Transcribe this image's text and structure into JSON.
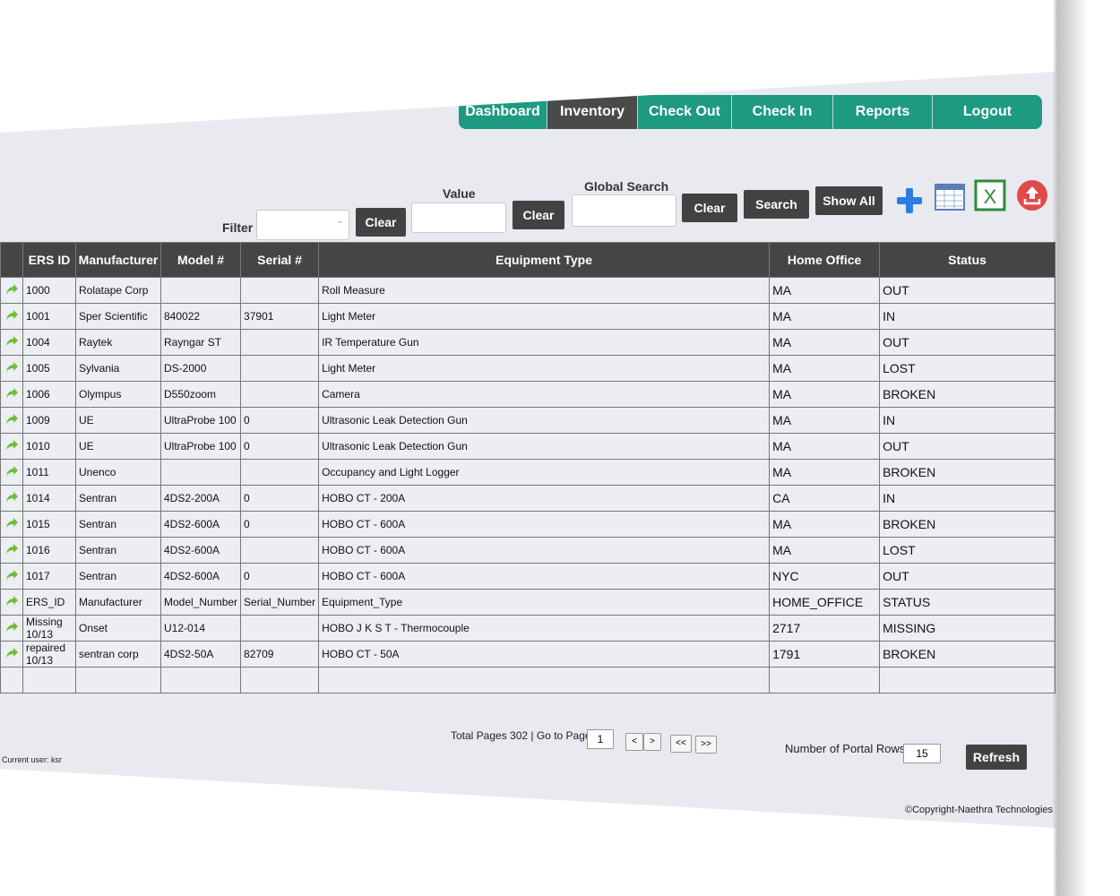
{
  "nav": [
    "Dashboard",
    "Inventory",
    "Check Out",
    "Check In",
    "Reports",
    "Logout"
  ],
  "filters": {
    "filter_label": "Filter",
    "value_label": "Value",
    "global_label": "Global Search",
    "clear": "Clear",
    "search": "Search",
    "show_all": "Show All"
  },
  "icons": {
    "add": "plus-icon",
    "grid": "table-icon",
    "excel": "excel-icon",
    "upload": "upload-icon"
  },
  "colors": {
    "accent": "#1e9a80",
    "active": "#4a4a4a",
    "header": "#454545"
  },
  "table": {
    "headers": [
      "ERS ID",
      "Manufacturer",
      "Model #",
      "Serial #",
      "Equipment Type",
      "Home Office",
      "Status"
    ],
    "rows": [
      [
        "1000",
        "Rolatape Corp",
        "",
        "",
        "Roll Measure",
        "MA",
        "OUT"
      ],
      [
        "1001",
        "Sper Scientific",
        "840022",
        "37901",
        "Light Meter",
        "MA",
        "IN"
      ],
      [
        "1004",
        "Raytek",
        "Rayngar ST",
        "",
        "IR Temperature Gun",
        "MA",
        "OUT"
      ],
      [
        "1005",
        "Sylvania",
        "DS-2000",
        "",
        "Light Meter",
        "MA",
        "LOST"
      ],
      [
        "1006",
        "Olympus",
        "D550zoom",
        "",
        "Camera",
        "MA",
        "BROKEN"
      ],
      [
        "1009",
        "UE",
        "UltraProbe 100",
        "0",
        "Ultrasonic Leak Detection Gun",
        "MA",
        "IN"
      ],
      [
        "1010",
        "UE",
        "UltraProbe 100",
        "0",
        "Ultrasonic Leak Detection Gun",
        "MA",
        "OUT"
      ],
      [
        "1011",
        "Unenco",
        "",
        "",
        "Occupancy and Light Logger",
        "MA",
        "BROKEN"
      ],
      [
        "1014",
        "Sentran",
        "4DS2-200A",
        "0",
        "HOBO CT - 200A",
        "CA",
        "IN"
      ],
      [
        "1015",
        "Sentran",
        "4DS2-600A",
        "0",
        "HOBO CT - 600A",
        "MA",
        "BROKEN"
      ],
      [
        "1016",
        "Sentran",
        "4DS2-600A",
        "",
        "HOBO CT - 600A",
        "MA",
        "LOST"
      ],
      [
        "1017",
        "Sentran",
        "4DS2-600A",
        "0",
        "HOBO CT - 600A",
        "NYC",
        "OUT"
      ],
      [
        "ERS_ID",
        "Manufacturer",
        "Model_Number",
        "Serial_Number",
        "Equipment_Type",
        "HOME_OFFICE",
        "STATUS"
      ],
      [
        "Missing 10/13",
        "Onset",
        "U12-014",
        "",
        "HOBO J K S T - Thermocouple",
        "2717",
        "MISSING"
      ],
      [
        "repaired 10/13",
        "sentran corp",
        "4DS2-50A",
        "82709",
        "HOBO CT - 50A",
        "1791",
        "BROKEN"
      ]
    ]
  },
  "footer": {
    "total_pages": "Total Pages 302 | Go to Page",
    "page": "1",
    "prev": "<",
    "next": ">",
    "first": "<<",
    "last": ">>",
    "rows_label": "Number of Portal Rows",
    "rows": "15",
    "refresh": "Refresh",
    "current_user": "Current user: ksr",
    "copyright": "©Copyright-Naethra Technologies"
  }
}
